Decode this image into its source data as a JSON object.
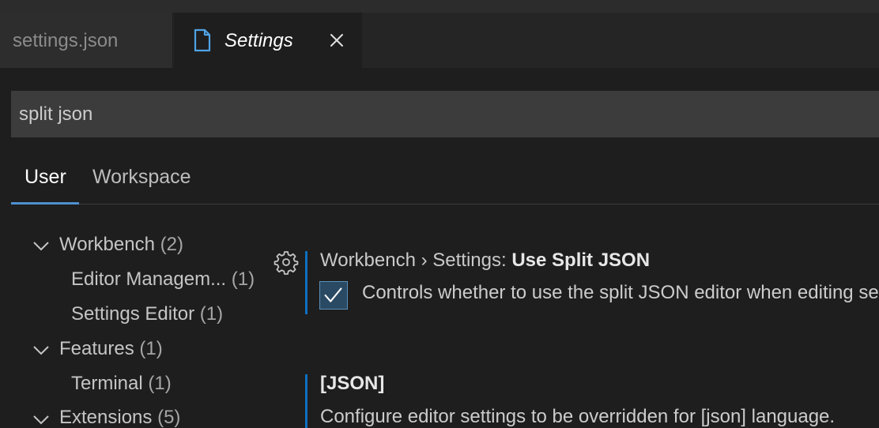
{
  "tabs": [
    {
      "label": "settings.json",
      "active": false
    },
    {
      "label": "Settings",
      "active": true
    }
  ],
  "search": {
    "value": "split json"
  },
  "scope_tabs": {
    "user": "User",
    "workspace": "Workspace"
  },
  "toc": {
    "workbench": {
      "label": "Workbench",
      "count": "(2)"
    },
    "editor_management": {
      "label": "Editor Managem...",
      "count": "(1)"
    },
    "settings_editor": {
      "label": "Settings Editor",
      "count": "(1)"
    },
    "features": {
      "label": "Features",
      "count": "(1)"
    },
    "terminal": {
      "label": "Terminal",
      "count": "(1)"
    },
    "extensions": {
      "label": "Extensions",
      "count": "(5)"
    }
  },
  "settings": {
    "split_json": {
      "category": "Workbench › Settings: ",
      "name": "Use Split JSON",
      "description": "Controls whether to use the split JSON editor when editing settings as JSON.",
      "checked": true
    },
    "json_lang": {
      "name": "[JSON]",
      "description": "Configure editor settings to be overridden for [json] language."
    }
  },
  "colors": {
    "background": "#1e1e1e",
    "accent": "#0e70c0",
    "tab_underline": "#4d90cf",
    "modified_dot": "#e2c08d"
  }
}
